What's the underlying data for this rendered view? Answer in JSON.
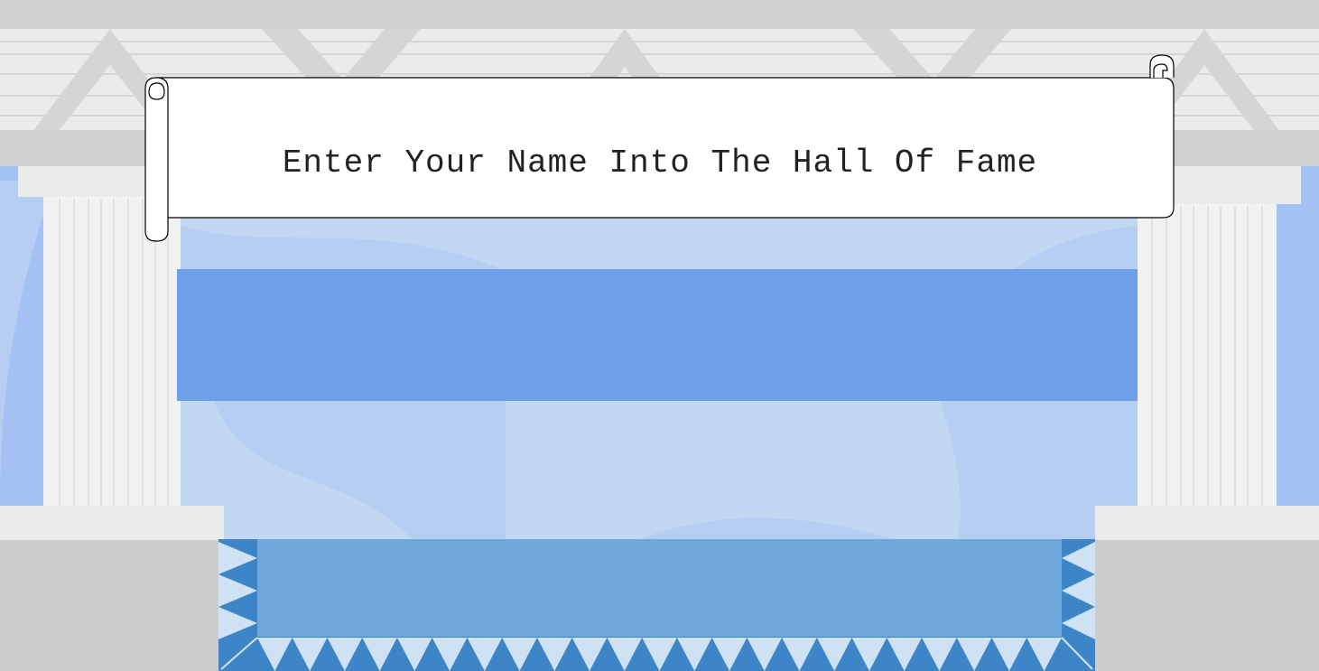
{
  "banner": {
    "title": "Enter Your Name Into The Hall Of Fame"
  },
  "name_entry": {
    "value": "",
    "placeholder": ""
  },
  "colors": {
    "sky": "#a4c1f3",
    "wall": "#c2d7f2",
    "wall_shade": "#b5cef1",
    "stone": "#d0d0d0",
    "stone_light": "#ebebeb",
    "column": "#f2f2f2",
    "input_fill": "#6e9fe9",
    "rug_fill": "#6fa8dc",
    "rug_border": "#3d85c6",
    "rug_triangle": "#cfe2f3"
  }
}
